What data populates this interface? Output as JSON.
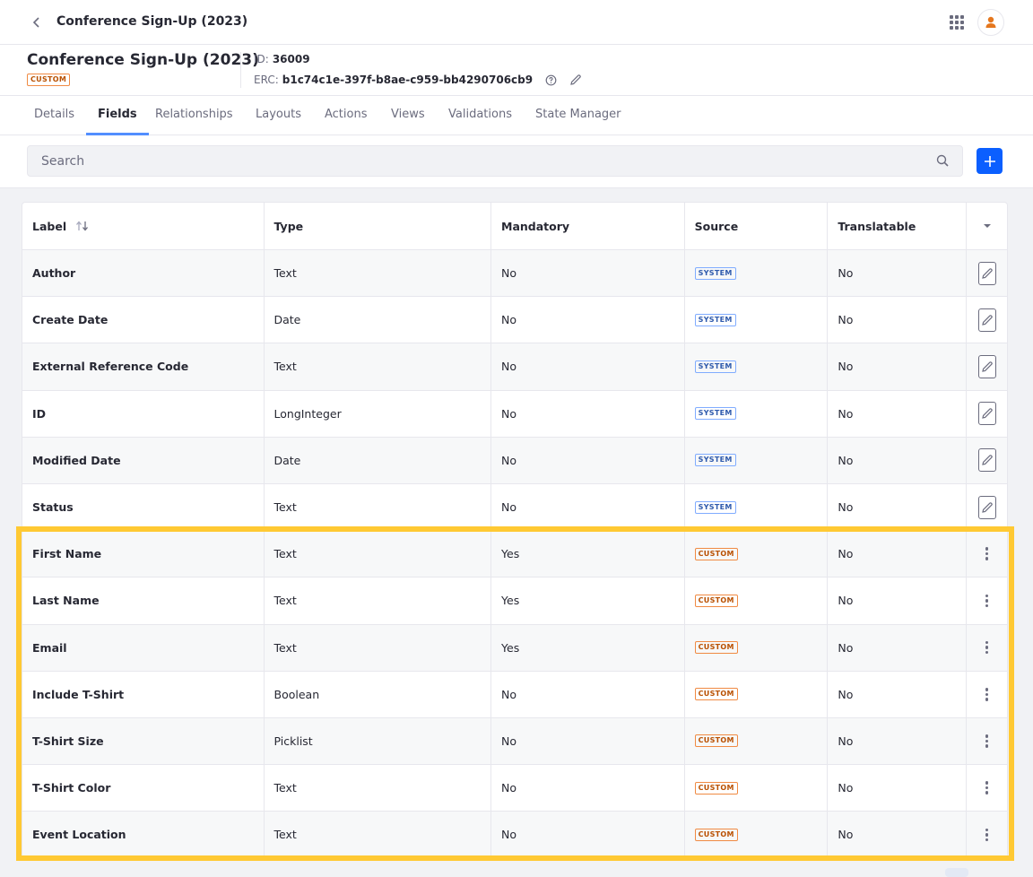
{
  "topbar": {
    "title": "Conference Sign-Up (2023)",
    "back_icon": "chevron-left-icon",
    "apps_icon": "grid-icon",
    "user_icon": "user-icon"
  },
  "header": {
    "title": "Conference Sign-Up (2023)",
    "badge": "CUSTOM",
    "id_label": "ID:",
    "id_value": "36009",
    "erc_label": "ERC:",
    "erc_value": "b1c74c1e-397f-b8ae-c959-bb4290706cb9"
  },
  "tabs": [
    {
      "label": "Details"
    },
    {
      "label": "Fields",
      "active": true
    },
    {
      "label": "Relationships"
    },
    {
      "label": "Layouts"
    },
    {
      "label": "Actions"
    },
    {
      "label": "Views"
    },
    {
      "label": "Validations"
    },
    {
      "label": "State Manager"
    }
  ],
  "search": {
    "placeholder": "Search",
    "value": ""
  },
  "table": {
    "columns": [
      "Label",
      "Type",
      "Mandatory",
      "Source",
      "Translatable"
    ],
    "rows": [
      {
        "label": "Author",
        "type": "Text",
        "mandatory": "No",
        "source": "SYSTEM",
        "translatable": "No"
      },
      {
        "label": "Create Date",
        "type": "Date",
        "mandatory": "No",
        "source": "SYSTEM",
        "translatable": "No"
      },
      {
        "label": "External Reference Code",
        "type": "Text",
        "mandatory": "No",
        "source": "SYSTEM",
        "translatable": "No"
      },
      {
        "label": "ID",
        "type": "LongInteger",
        "mandatory": "No",
        "source": "SYSTEM",
        "translatable": "No"
      },
      {
        "label": "Modified Date",
        "type": "Date",
        "mandatory": "No",
        "source": "SYSTEM",
        "translatable": "No"
      },
      {
        "label": "Status",
        "type": "Text",
        "mandatory": "No",
        "source": "SYSTEM",
        "translatable": "No"
      },
      {
        "label": "First Name",
        "type": "Text",
        "mandatory": "Yes",
        "source": "CUSTOM",
        "translatable": "No"
      },
      {
        "label": "Last Name",
        "type": "Text",
        "mandatory": "Yes",
        "source": "CUSTOM",
        "translatable": "No"
      },
      {
        "label": "Email",
        "type": "Text",
        "mandatory": "Yes",
        "source": "CUSTOM",
        "translatable": "No"
      },
      {
        "label": "Include T-Shirt",
        "type": "Boolean",
        "mandatory": "No",
        "source": "CUSTOM",
        "translatable": "No"
      },
      {
        "label": "T-Shirt Size",
        "type": "Picklist",
        "mandatory": "No",
        "source": "CUSTOM",
        "translatable": "No"
      },
      {
        "label": "T-Shirt Color",
        "type": "Text",
        "mandatory": "No",
        "source": "CUSTOM",
        "translatable": "No"
      },
      {
        "label": "Event Location",
        "type": "Text",
        "mandatory": "No",
        "source": "CUSTOM",
        "translatable": "No"
      }
    ]
  },
  "colors": {
    "accent": "#0b5fff",
    "tab_indicator": "#528eff",
    "custom_badge": "#b95000",
    "system_badge": "#2e5aac",
    "highlight": "#ffc933",
    "avatar": "#e5771e"
  }
}
